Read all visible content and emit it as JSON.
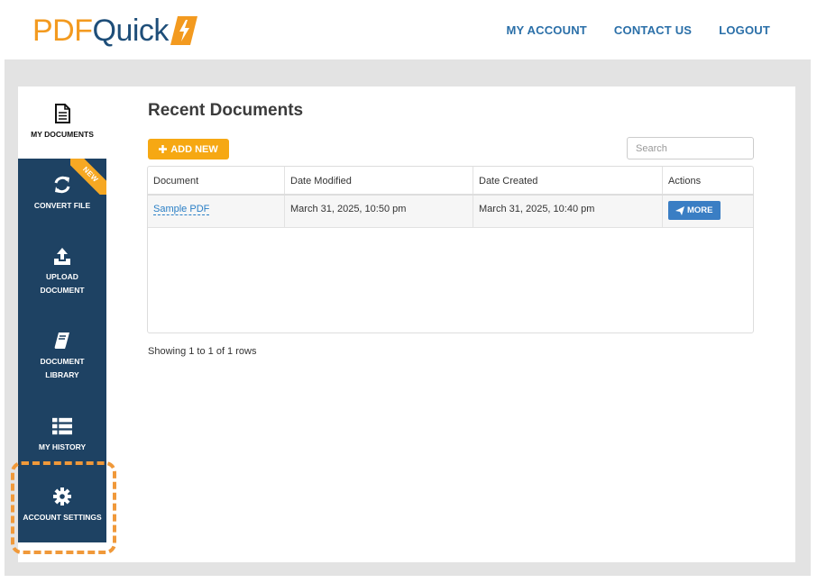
{
  "logo": {
    "part1": "PDF",
    "part2": "Quick"
  },
  "topnav": {
    "my_account": "MY ACCOUNT",
    "contact_us": "CONTACT US",
    "logout": "LOGOUT"
  },
  "sidebar": {
    "my_documents": "MY DOCUMENTS",
    "convert_file": "CONVERT FILE",
    "convert_badge": "NEW",
    "upload_line1": "UPLOAD",
    "upload_line2": "DOCUMENT",
    "library_line1": "DOCUMENT",
    "library_line2": "LIBRARY",
    "my_history": "MY HISTORY",
    "account_settings": "ACCOUNT SETTINGS"
  },
  "main": {
    "title": "Recent Documents",
    "add_new": "ADD NEW",
    "search_placeholder": "Search",
    "columns": [
      "Document",
      "Date Modified",
      "Date Created",
      "Actions"
    ],
    "rows": [
      {
        "document": "Sample PDF",
        "modified": "March 31, 2025, 10:50 pm",
        "created": "March 31, 2025, 10:40 pm",
        "action": "MORE"
      }
    ],
    "footer": "Showing 1 to 1 of 1 rows"
  },
  "colors": {
    "brand_orange": "#f39a1f",
    "brand_navy": "#1e4263",
    "link_blue": "#2a6fa8",
    "highlight": "#f0993a"
  }
}
